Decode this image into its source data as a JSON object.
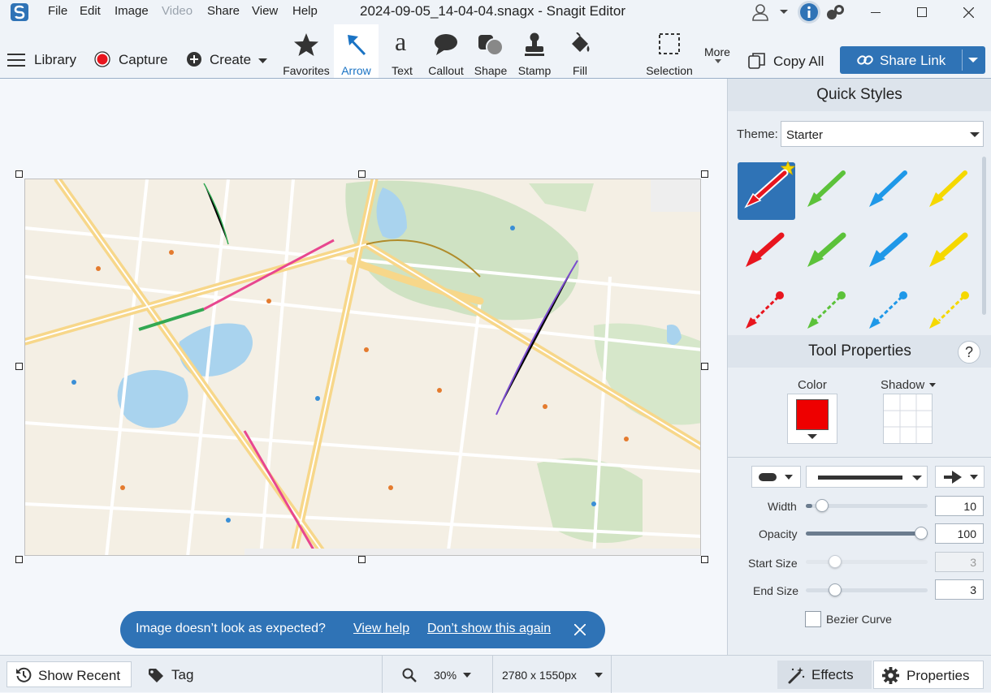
{
  "window": {
    "title": "2024-09-05_14-04-04.snagx - Snagit Editor",
    "menu": [
      "File",
      "Edit",
      "Image",
      "Video",
      "Share",
      "View",
      "Help"
    ],
    "disabled_menu": "Video"
  },
  "toolbar": {
    "library_label": "Library",
    "capture_label": "Capture",
    "create_label": "Create",
    "tools": [
      {
        "label": "Favorites",
        "icon": "star-icon"
      },
      {
        "label": "Arrow",
        "icon": "arrow-icon",
        "active": true
      },
      {
        "label": "Text",
        "icon": "text-icon"
      },
      {
        "label": "Callout",
        "icon": "callout-icon"
      },
      {
        "label": "Shape",
        "icon": "shape-icon"
      },
      {
        "label": "Stamp",
        "icon": "stamp-icon"
      },
      {
        "label": "Fill",
        "icon": "fill-icon"
      },
      {
        "label": "Selection",
        "icon": "selection-icon"
      }
    ],
    "more_label": "More",
    "copy_all_label": "Copy All",
    "share_link_label": "Share Link",
    "accent": "#2f73b6"
  },
  "banner": {
    "message": "Image doesn’t look as expected?",
    "view_help": "View help",
    "dont_show": "Don’t show this again"
  },
  "quick_styles": {
    "heading": "Quick Styles",
    "theme_label": "Theme:",
    "theme_value": "Starter",
    "colors": [
      "#e8151e",
      "#5cc23a",
      "#1f98e8",
      "#f5d800"
    ]
  },
  "tool_properties": {
    "heading": "Tool Properties",
    "help": "?",
    "color_label": "Color",
    "color_value": "#ee0000",
    "shadow_label": "Shadow",
    "width_label": "Width",
    "width_value": "10",
    "width_fraction": 0.05,
    "opacity_label": "Opacity",
    "opacity_value": "100",
    "opacity_fraction": 1.0,
    "start_size_label": "Start Size",
    "start_size_value": "3",
    "end_size_label": "End Size",
    "end_size_value": "3",
    "bezier_label": "Bezier Curve",
    "bezier_checked": false
  },
  "statusbar": {
    "show_recent": "Show Recent",
    "tag": "Tag",
    "zoom": "30%",
    "dimensions": "2780 x 1550px",
    "effects": "Effects",
    "properties": "Properties"
  }
}
